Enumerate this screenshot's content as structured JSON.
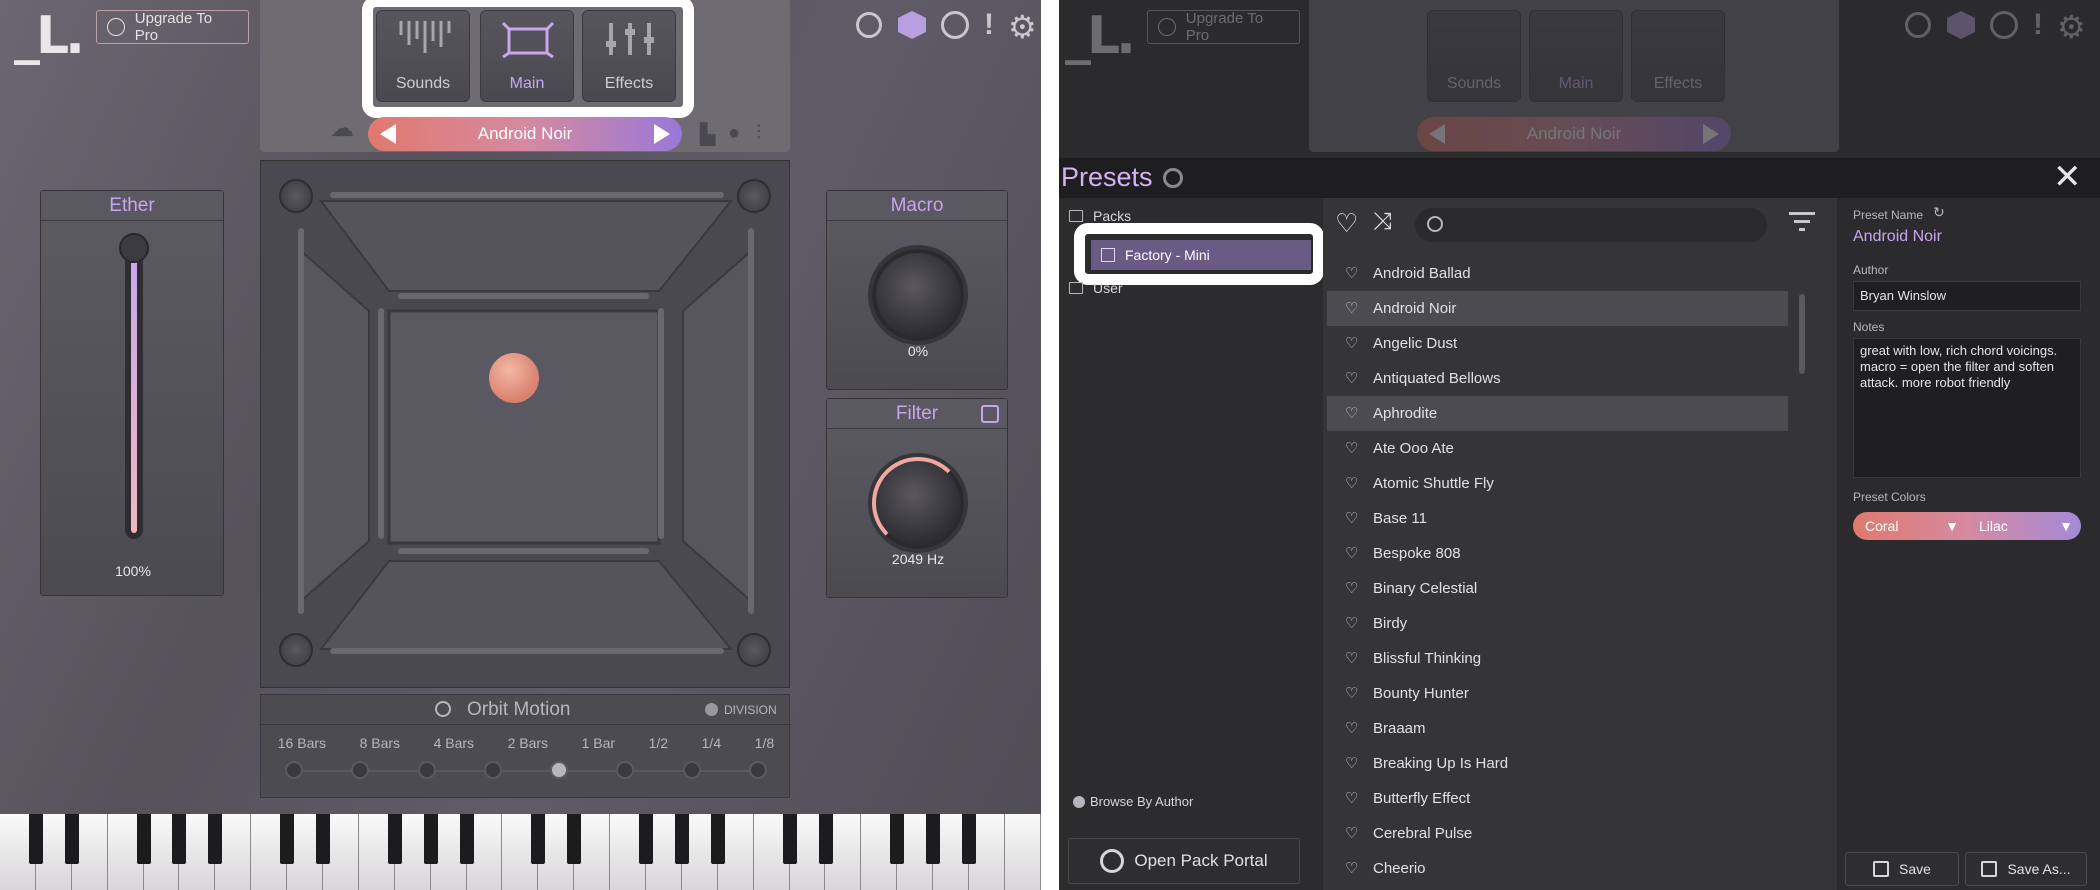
{
  "app": {
    "upgrade_label": "Upgrade To Pro",
    "tabs": [
      {
        "label": "Sounds"
      },
      {
        "label": "Main"
      },
      {
        "label": "Effects"
      }
    ],
    "preset_name": "Android Noir"
  },
  "ether": {
    "title": "Ether",
    "value": "100%"
  },
  "macro": {
    "title": "Macro",
    "value": "0%"
  },
  "filter": {
    "title": "Filter",
    "value": "2049 Hz"
  },
  "orbit": {
    "title": "Orbit Motion",
    "division_label": "DIVISION",
    "bars": [
      "16 Bars",
      "8 Bars",
      "4 Bars",
      "2 Bars",
      "1 Bar",
      "1/2",
      "1/4",
      "1/8"
    ],
    "selected_index": 4
  },
  "presets_panel": {
    "title": "Presets",
    "tree": {
      "packs": "Packs",
      "factory_mini": "Factory - Mini",
      "user": "User"
    },
    "browse_by_author": "Browse By Author",
    "open_pack_portal": "Open Pack Portal",
    "search_placeholder": "",
    "list": [
      "Android Ballad",
      "Android Noir",
      "Angelic Dust",
      "Antiquated Bellows",
      "Aphrodite",
      "Ate Ooo Ate",
      "Atomic Shuttle Fly",
      "Base 11",
      "Bespoke 808",
      "Binary Celestial",
      "Birdy",
      "Blissful Thinking",
      "Bounty Hunter",
      "Braaam",
      "Breaking Up Is Hard",
      "Butterfly Effect",
      "Cerebral Pulse",
      "Cheerio"
    ],
    "selected_item": "Android Noir",
    "hover_item": "Aphrodite",
    "details": {
      "preset_name_label": "Preset Name",
      "preset_name": "Android Noir",
      "author_label": "Author",
      "author": "Bryan Winslow",
      "notes_label": "Notes",
      "notes": "great with low, rich chord voicings. macro = open the filter and soften attack. more robot friendly",
      "colors_label": "Preset Colors",
      "color1": "Coral",
      "color2": "Lilac"
    },
    "save_label": "Save",
    "save_as_label": "Save As..."
  },
  "colors": {
    "accent": "#c8a7f0",
    "coral": "#e0796e",
    "lilac": "#9a78d8"
  }
}
